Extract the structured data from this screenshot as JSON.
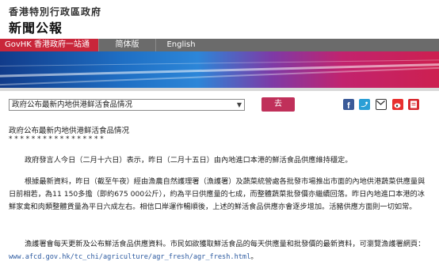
{
  "header": {
    "site_name": "香港特別行政區政府",
    "press_title": "新聞公報"
  },
  "topnav": {
    "govhk": "GovHK 香港政府一站通",
    "simplified": "简体版",
    "english": "English"
  },
  "colors": {
    "govhk_red": "#c9263a",
    "nav_grey": "#6b6b6b",
    "button_pink": "#c0305a",
    "link_blue": "#2c5aa0"
  },
  "selector": {
    "selected": "政府公布最新内地供港鲜活食品情况",
    "button": "去"
  },
  "share_icons": [
    "facebook-icon",
    "twitter-icon",
    "email-icon",
    "weibo-icon",
    "print-icon"
  ],
  "article": {
    "title": "政府公布最新内地供港鲜活食品情况",
    "stars": "*****************",
    "p1": "政府發言人今日（二月十六日）表示，昨日（二月十五日）由內地進口本港的鮮活食品供應維持穩定。",
    "p2": "根據最新資料，昨日（截至午夜）經由漁農自然護理署（漁護署）及蔬菜統營處各批發市場推出市面的內地供港蔬菜供應量與日前相若，為11 150多擔（即約675 000公斤），約為平日供應量的七成，而整體蔬菜批發價亦繼續回落。昨日內地進口本港的冰鮮家禽和肉類整體貨量為平日六成左右。相信口岸運作暢順後，上述的鮮活食品供應亦會逐步增加。活豬供應方面則一切如常。",
    "p3_text": "漁護署會每天更新及公布鮮活食品供應資料。市民如欲獲取鮮活食品的每天供應量和批發價的最新資料，可瀏覽漁護署網頁：",
    "p3_link": "www.afcd.gov.hk/tc_chi/agriculture/agr_fresh/agr_fresh.html",
    "p3_end": "。"
  }
}
